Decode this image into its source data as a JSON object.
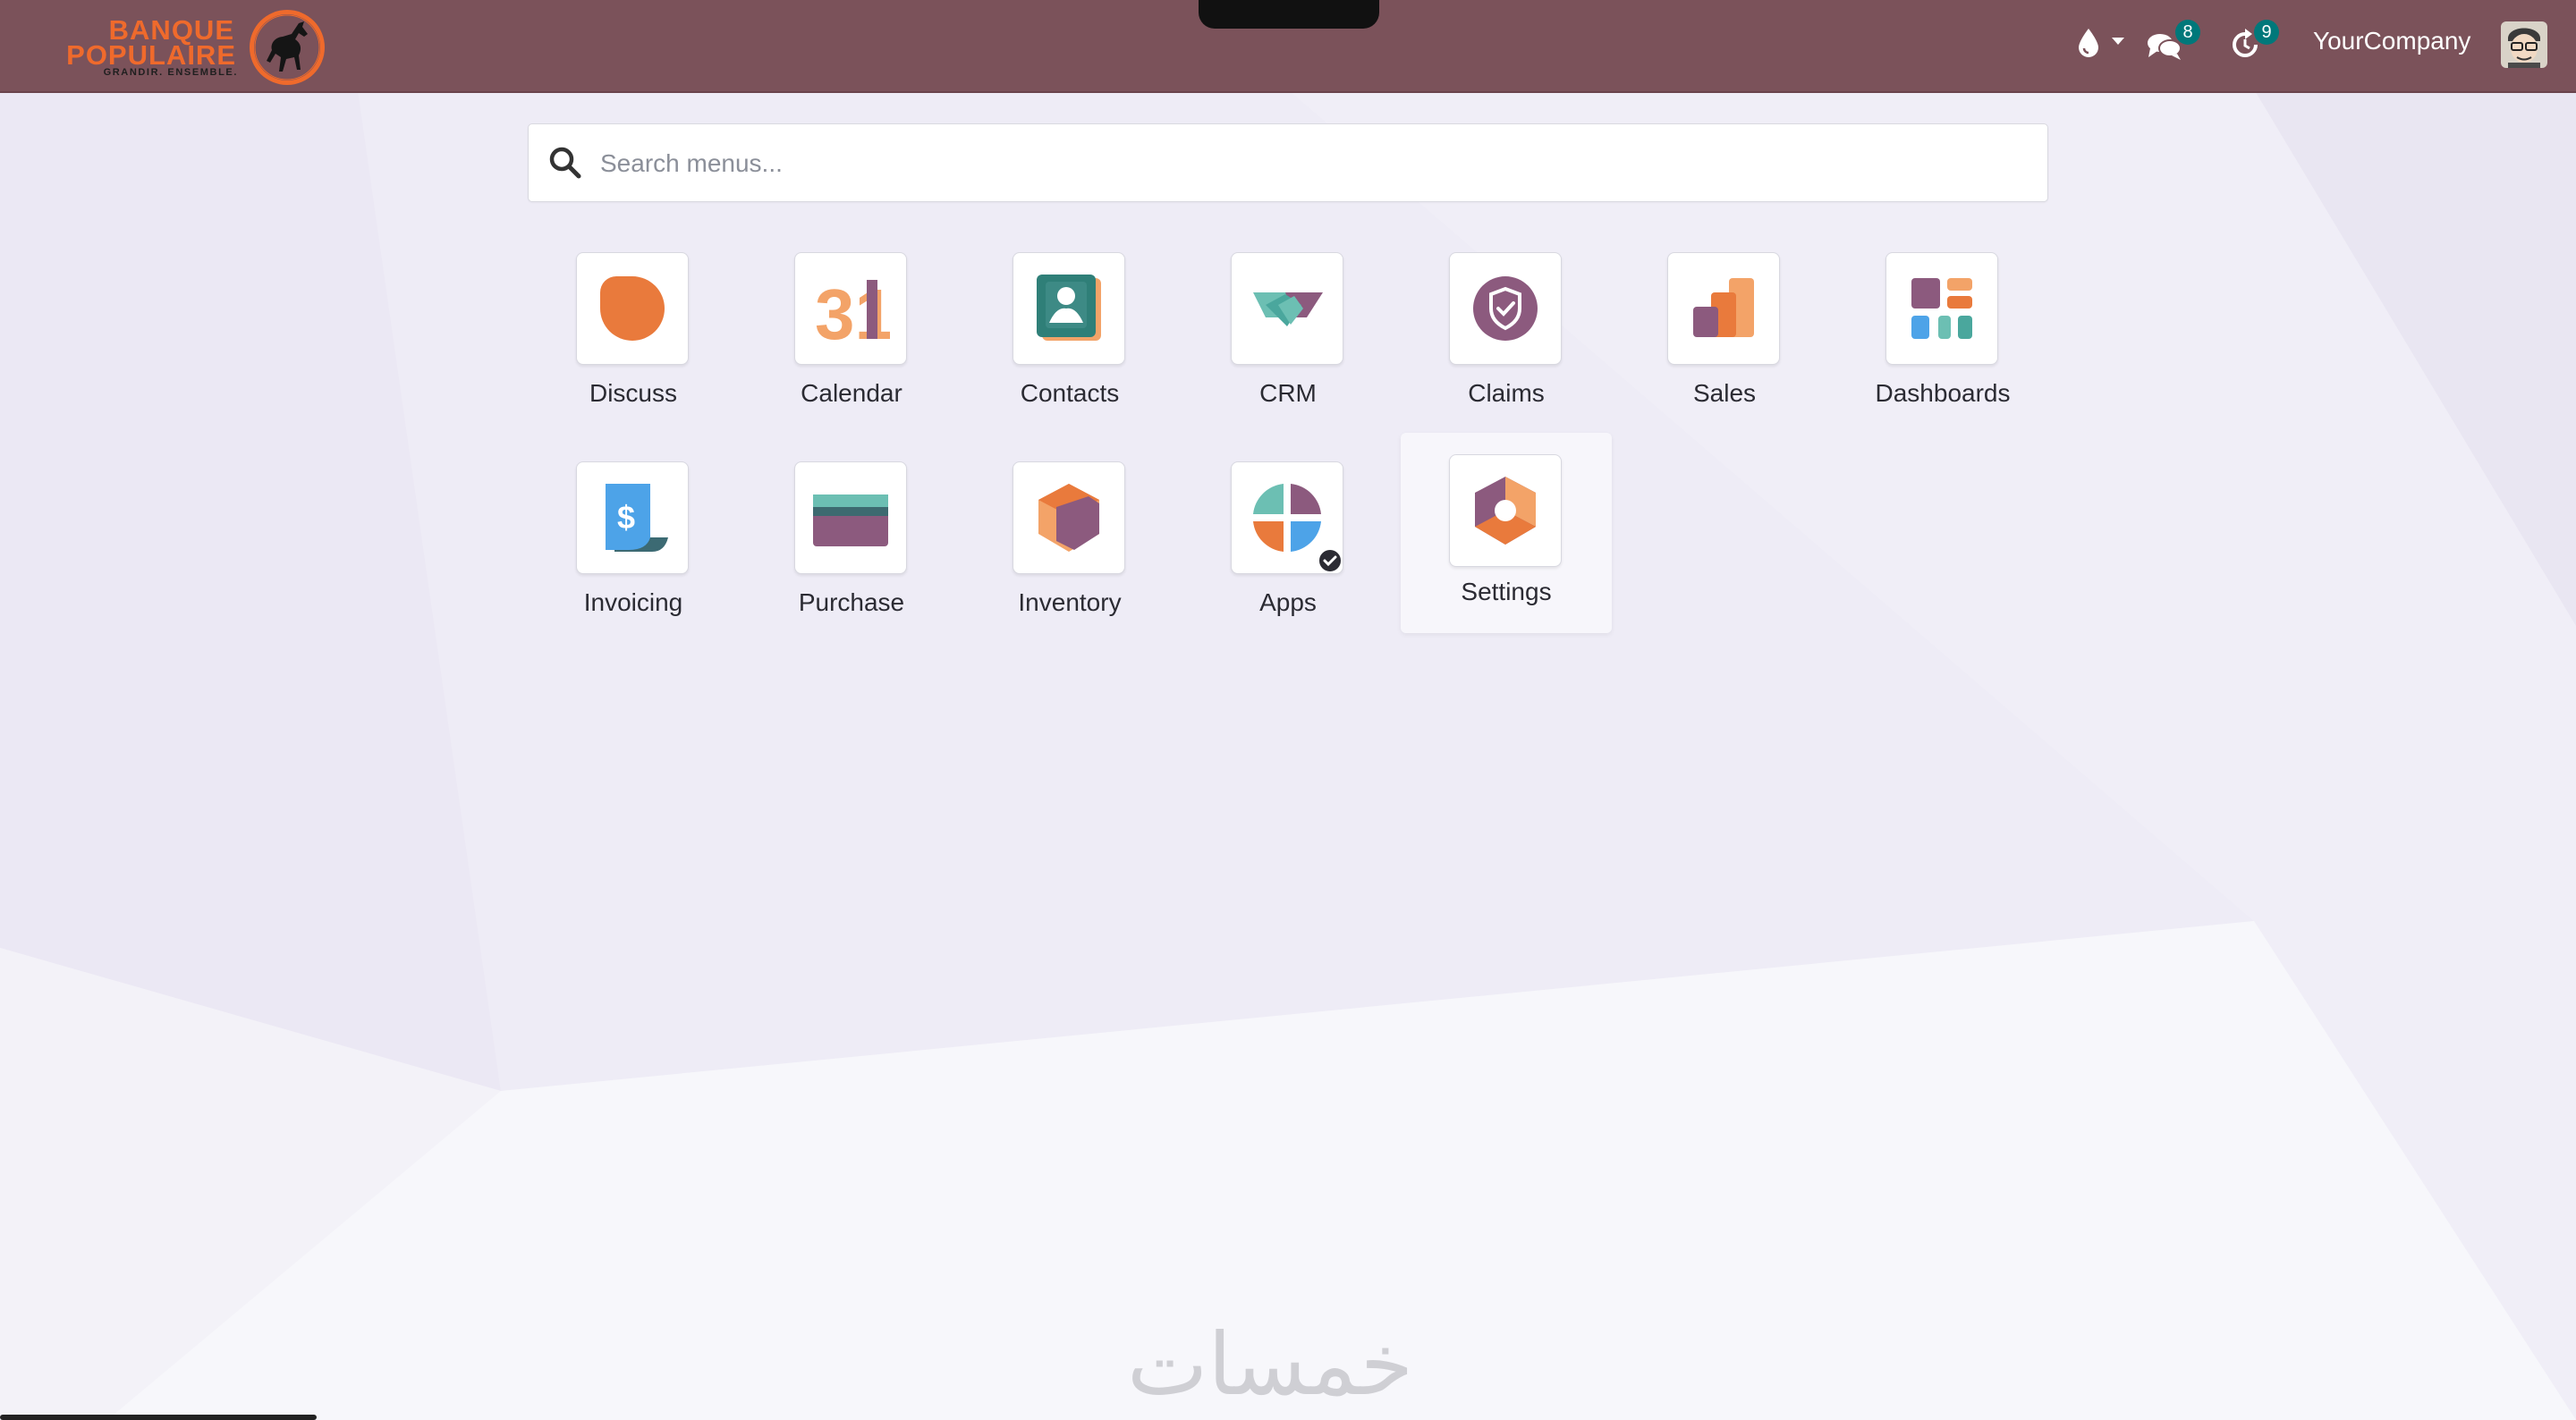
{
  "navbar": {
    "brand_line1": "BANQUE",
    "brand_line2": "POPULAIRE",
    "brand_tagline": "GRANDIR. ENSEMBLE.",
    "messages_badge": "8",
    "activities_badge": "9",
    "company_name": "YourCompany",
    "bg_color": "#7b525a"
  },
  "search": {
    "placeholder": "Search menus..."
  },
  "apps": [
    {
      "label": "Discuss",
      "icon": "discuss-icon"
    },
    {
      "label": "Calendar",
      "icon": "calendar-icon",
      "icon_text": "31"
    },
    {
      "label": "Contacts",
      "icon": "contacts-icon"
    },
    {
      "label": "CRM",
      "icon": "crm-handshake-icon"
    },
    {
      "label": "Claims",
      "icon": "shield-check-icon"
    },
    {
      "label": "Sales",
      "icon": "sales-bars-icon"
    },
    {
      "label": "Dashboards",
      "icon": "dashboards-icon"
    },
    {
      "label": "Invoicing",
      "icon": "invoice-icon",
      "icon_text": "$"
    },
    {
      "label": "Purchase",
      "icon": "purchase-card-icon"
    },
    {
      "label": "Inventory",
      "icon": "inventory-box-icon"
    },
    {
      "label": "Apps",
      "icon": "apps-icon"
    },
    {
      "label": "Settings",
      "icon": "settings-gear-icon"
    }
  ],
  "watermark": "خمسات"
}
